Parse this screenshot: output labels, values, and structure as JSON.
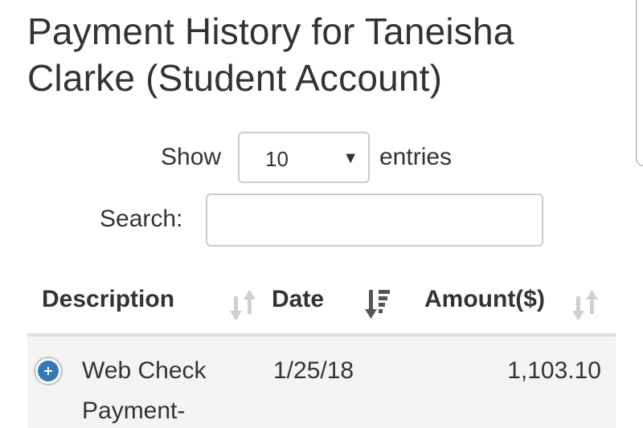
{
  "page": {
    "title": "Payment History for Taneisha Clarke (Student Account)"
  },
  "length_control": {
    "show_label": "Show",
    "selected": "10",
    "entries_label": "entries"
  },
  "search": {
    "label": "Search:",
    "value": "",
    "placeholder": ""
  },
  "table": {
    "columns": [
      {
        "label": "Description",
        "sort": "both"
      },
      {
        "label": "Date",
        "sort": "descending"
      },
      {
        "label": "Amount($)",
        "sort": "both"
      }
    ],
    "rows": [
      {
        "description": "Web Check Payment-",
        "date": "1/25/18",
        "amount": "1,103.10"
      }
    ]
  },
  "colors": {
    "text": "#333333",
    "expand_button": "#337ab7",
    "row_background": "#f4f4f4",
    "sort_inactive": "#d0d0d0",
    "sort_active": "#555555"
  },
  "icons": {
    "expand": "plus-circle-icon",
    "sort_both": "sort-both-icon",
    "sort_desc": "sort-descending-icon",
    "dropdown": "caret-down-icon"
  }
}
